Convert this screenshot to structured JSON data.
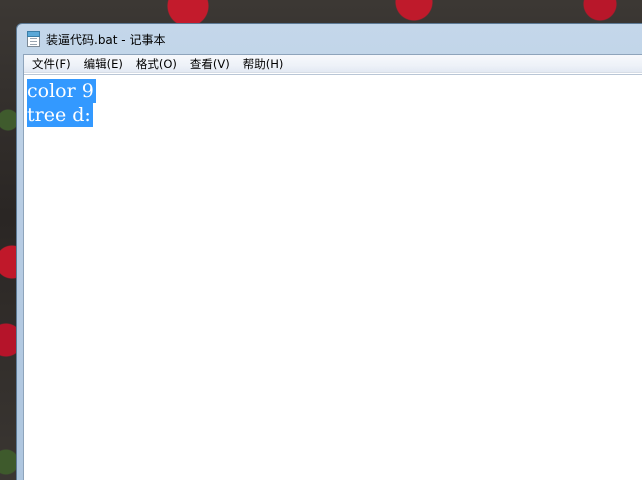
{
  "window": {
    "title": "装逼代码.bat - 记事本",
    "icon": "notepad-icon"
  },
  "menu": {
    "items": [
      "文件(F)",
      "编辑(E)",
      "格式(O)",
      "查看(V)",
      "帮助(H)"
    ]
  },
  "editor": {
    "lines": [
      "color 9",
      "tree d:"
    ],
    "selection_color": "#3399ff",
    "selected_text_color": "#ffffff"
  },
  "desktop": {
    "wallpaper": "strawberries"
  }
}
